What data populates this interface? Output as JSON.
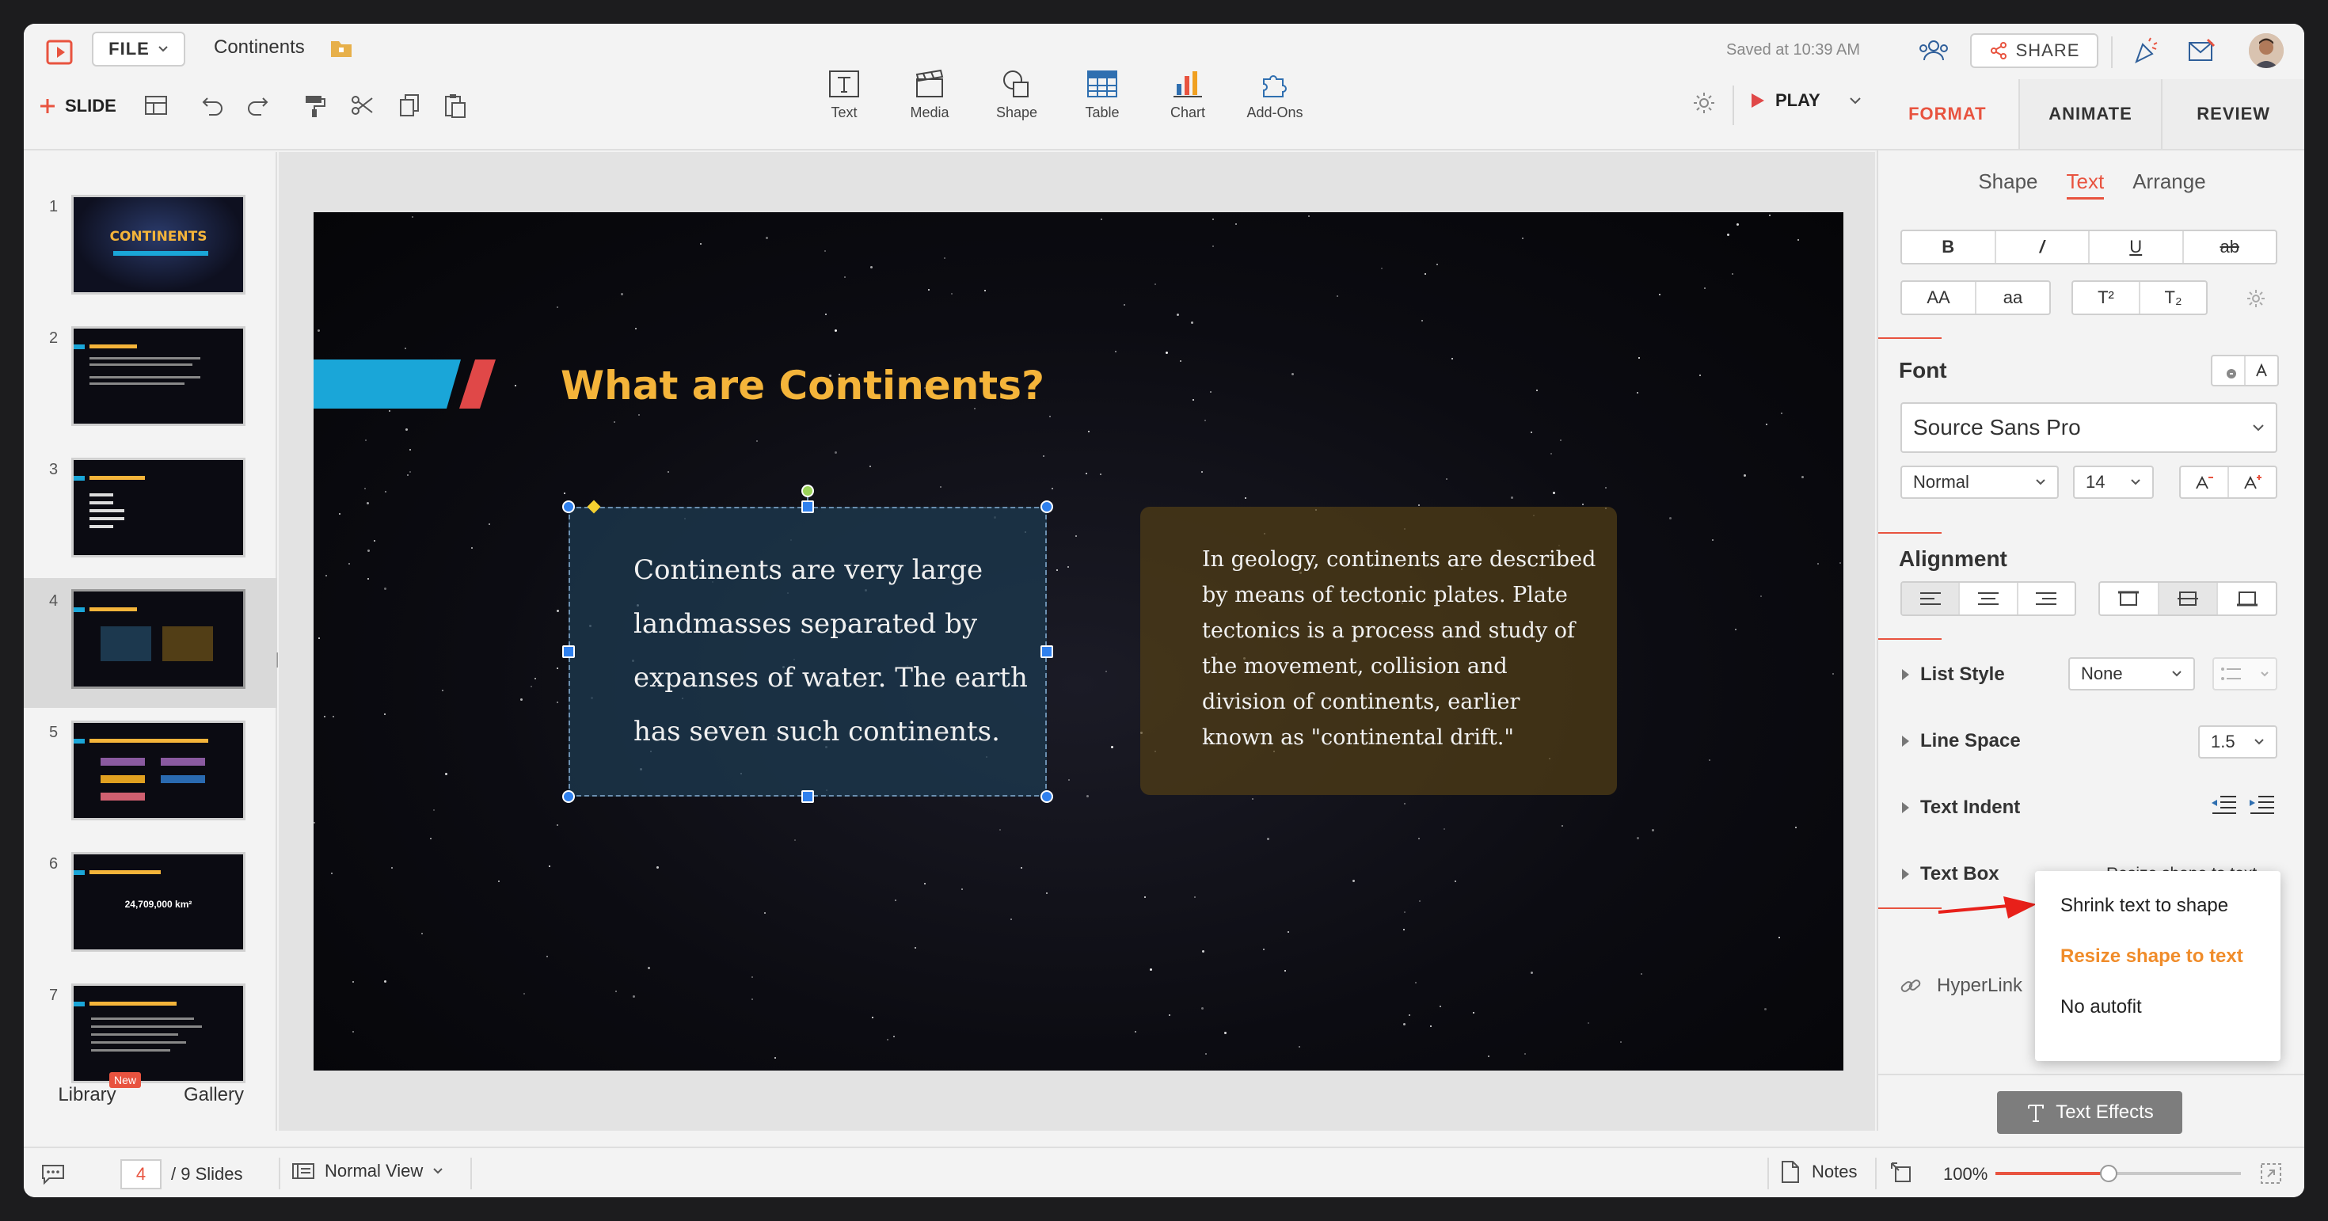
{
  "app": {
    "file_menu": "FILE",
    "doc_title": "Continents",
    "saved_status": "Saved at 10:39 AM",
    "share_label": "SHARE"
  },
  "toolbar": {
    "slide_label": "SLIDE",
    "play_label": "PLAY",
    "insert": [
      {
        "label": "Text",
        "icon": "text-box-icon"
      },
      {
        "label": "Media",
        "icon": "media-icon"
      },
      {
        "label": "Shape",
        "icon": "shape-icon"
      },
      {
        "label": "Table",
        "icon": "table-icon"
      },
      {
        "label": "Chart",
        "icon": "chart-icon"
      },
      {
        "label": "Add-Ons",
        "icon": "puzzle-icon"
      }
    ]
  },
  "right_tabs": [
    "FORMAT",
    "ANIMATE",
    "REVIEW"
  ],
  "format_subtabs": [
    "Shape",
    "Text",
    "Arrange"
  ],
  "text_style_buttons": [
    "B",
    "/",
    "U",
    "ab"
  ],
  "case_buttons": [
    "AA",
    "aa",
    "T²",
    "T₂"
  ],
  "font": {
    "section_title": "Font",
    "family": "Source Sans Pro",
    "weight": "Normal",
    "size": "14"
  },
  "alignment": {
    "section_title": "Alignment"
  },
  "list_style": {
    "label": "List Style",
    "value": "None"
  },
  "line_space": {
    "label": "Line Space",
    "value": "1.5"
  },
  "text_indent": {
    "label": "Text Indent"
  },
  "text_box": {
    "label": "Text Box",
    "value": "Resize shape to text"
  },
  "hyperlink": {
    "label": "HyperLink"
  },
  "autofit_menu": {
    "options": [
      "Shrink text to shape",
      "Resize shape to text",
      "No autofit"
    ],
    "selected": "Resize shape to text"
  },
  "text_effects_label": "Text Effects",
  "slides_panel": {
    "numbers": [
      "1",
      "2",
      "3",
      "4",
      "5",
      "6",
      "7"
    ],
    "selected": "4",
    "thumb1_title": "CONTINENTS",
    "thumb6_value": "24,709,000 km²",
    "library_label": "Library",
    "library_badge": "New",
    "gallery_label": "Gallery"
  },
  "slide": {
    "title": "What are Continents?",
    "box1_text": "Continents are very large landmasses separated by expanses of water. The earth has seven such continents.",
    "box2_text": "In geology, continents are described by means of tectonic plates. Plate tectonics is a process and study of the movement, collision and division of continents, earlier known as \"continental drift.\""
  },
  "statusbar": {
    "current_page": "4",
    "total_slides": "/ 9 Slides",
    "view_mode": "Normal View",
    "notes_label": "Notes",
    "zoom": "100%",
    "zoom_fraction": 0.46
  },
  "colors": {
    "accent": "#e8533f",
    "title_yellow": "#f4b43a",
    "stripe_blue": "#1aa6d8",
    "stripe_red": "#e04848",
    "menu_selected": "#f08c2a"
  }
}
